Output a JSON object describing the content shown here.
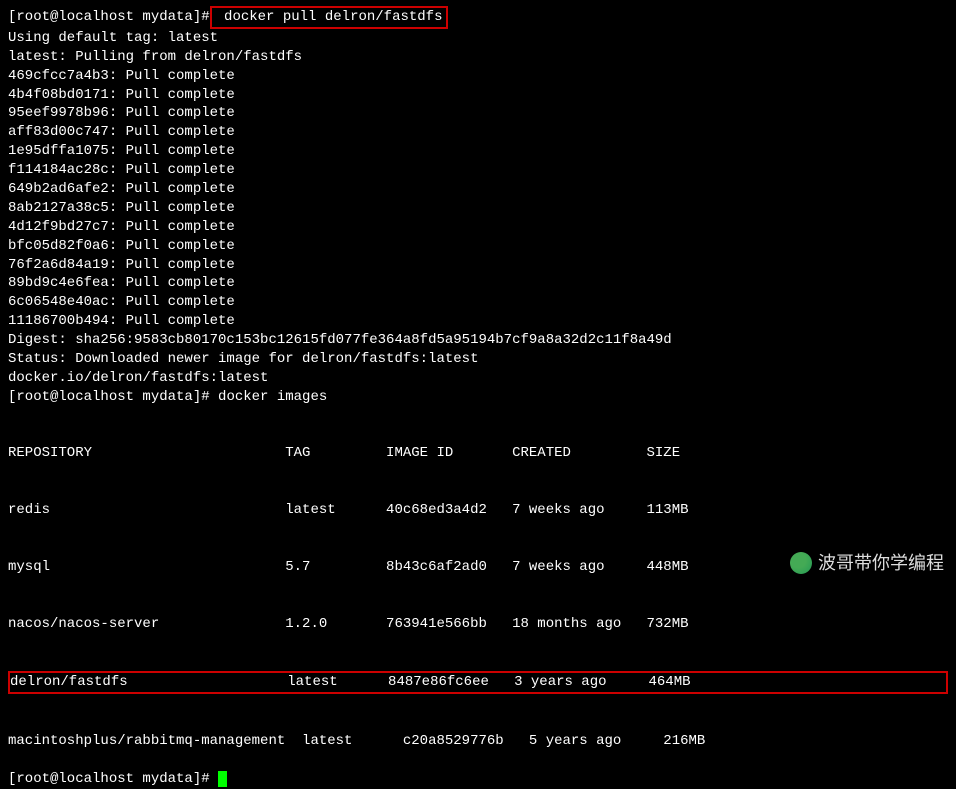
{
  "prompt1": {
    "user": "[root@localhost mydata]#",
    "cmd": " docker pull delron/fastdfs"
  },
  "pull_output": [
    "Using default tag: latest",
    "latest: Pulling from delron/fastdfs",
    "469cfcc7a4b3: Pull complete",
    "4b4f08bd0171: Pull complete",
    "95eef9978b96: Pull complete",
    "aff83d00c747: Pull complete",
    "1e95dffa1075: Pull complete",
    "f114184ac28c: Pull complete",
    "649b2ad6afe2: Pull complete",
    "8ab2127a38c5: Pull complete",
    "4d12f9bd27c7: Pull complete",
    "bfc05d82f0a6: Pull complete",
    "76f2a6d84a19: Pull complete",
    "89bd9c4e6fea: Pull complete",
    "6c06548e40ac: Pull complete",
    "11186700b494: Pull complete",
    "Digest: sha256:9583cb80170c153bc12615fd077fe364a8fd5a95194b7cf9a8a32d2c11f8a49d",
    "Status: Downloaded newer image for delron/fastdfs:latest",
    "docker.io/delron/fastdfs:latest"
  ],
  "prompt2": {
    "user": "[root@localhost mydata]#",
    "cmd": " docker images"
  },
  "images_header": "REPOSITORY                       TAG         IMAGE ID       CREATED         SIZE",
  "images_rows": [
    "redis                            latest      40c68ed3a4d2   7 weeks ago     113MB",
    "mysql                            5.7         8b43c6af2ad0   7 weeks ago     448MB",
    "nacos/nacos-server               1.2.0       763941e566bb   18 months ago   732MB"
  ],
  "highlighted_row": "delron/fastdfs                   latest      8487e86fc6ee   3 years ago     464MB",
  "images_rows_after": [
    "macintoshplus/rabbitmq-management  latest      c20a8529776b   5 years ago     216MB"
  ],
  "prompt3": {
    "user": "[root@localhost mydata]#",
    "cmd": " "
  },
  "watermark": "波哥带你学编程"
}
